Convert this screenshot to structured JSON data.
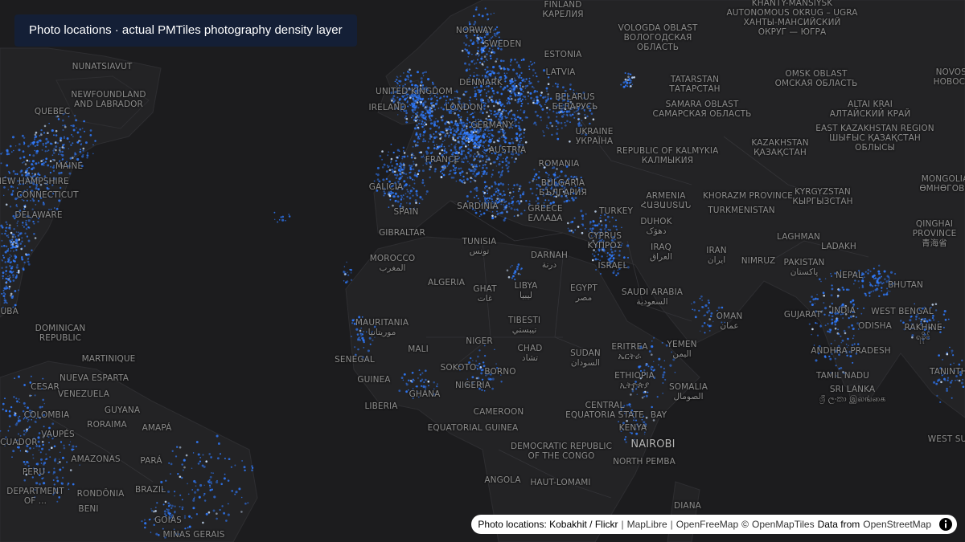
{
  "title": "Photo locations · actual PMTiles photography density layer",
  "attribution": {
    "credit": "Photo locations: Kobakhit / Flickr",
    "links": [
      "MapLibre",
      "OpenFreeMap",
      "OpenMapTiles"
    ],
    "copyright_symbol": "©",
    "data_from": "Data from",
    "osm": "OpenStreetMap",
    "info_icon": "info-icon"
  },
  "colors": {
    "background": "#1c1c1e",
    "land": "#1f1f21",
    "density": "#2f7bff",
    "density_hot": "#cfe4ff",
    "label": "#8c8c8c"
  },
  "labels": [
    {
      "name": "label-finland",
      "lines": [
        "FINLAND",
        "КАРЕЛИЯ"
      ]
    },
    {
      "name": "label-khanty",
      "lines": [
        "KHANTY-MANSIYSK",
        "AUTONOMOUS OKRUG – UGRA",
        "ХАНТЫ-МАНСИЙСКИЙ",
        "ОКРУГ — ЮГРА"
      ]
    },
    {
      "name": "label-vologda",
      "lines": [
        "VOLOGDA OBLAST",
        "ВОЛОГОДСКАЯ",
        "ОБЛАСТЬ"
      ]
    },
    {
      "name": "label-norway",
      "lines": [
        "NORWAY"
      ]
    },
    {
      "name": "label-sweden",
      "lines": [
        "SWEDEN"
      ]
    },
    {
      "name": "label-estonia",
      "lines": [
        "ESTONIA"
      ]
    },
    {
      "name": "label-latvia",
      "lines": [
        "LATVIA"
      ]
    },
    {
      "name": "label-nunatsiavut",
      "lines": [
        "NUNATSIAVUT"
      ]
    },
    {
      "name": "label-newfoundland",
      "lines": [
        "NEWFOUNDLAND",
        "AND LABRADOR"
      ]
    },
    {
      "name": "label-quebec",
      "lines": [
        "QUEBEC"
      ]
    },
    {
      "name": "label-tatarstan",
      "lines": [
        "TATARSTAN",
        "ТАТАРСТАН"
      ]
    },
    {
      "name": "label-omsk",
      "lines": [
        "OMSK OBLAST",
        "ОМСКАЯ ОБЛАСТЬ"
      ]
    },
    {
      "name": "label-novosib",
      "lines": [
        "NOVOSIB",
        "НОВОСИБ"
      ]
    },
    {
      "name": "label-united-kingdom",
      "lines": [
        "UNITED KINGDOM"
      ]
    },
    {
      "name": "label-ireland",
      "lines": [
        "IRELAND"
      ]
    },
    {
      "name": "label-denmark",
      "lines": [
        "DENMARK"
      ]
    },
    {
      "name": "label-london",
      "lines": [
        "LONDON"
      ]
    },
    {
      "name": "label-belarus",
      "lines": [
        "BELARUS",
        "БЕЛАРУСЬ"
      ]
    },
    {
      "name": "label-samara",
      "lines": [
        "SAMARA OBLAST",
        "САМАРСКАЯ ОБЛАСТЬ"
      ]
    },
    {
      "name": "label-altai",
      "lines": [
        "ALTAI KRAI",
        "АЛТАЙСКИЙ КРАЙ"
      ]
    },
    {
      "name": "label-germany",
      "lines": [
        "GERMANY"
      ]
    },
    {
      "name": "label-ukraine",
      "lines": [
        "UKRAINE",
        "УКРАЇНА"
      ]
    },
    {
      "name": "label-east-kazakhstan",
      "lines": [
        "EAST KAZAKHSTAN REGION",
        "ШЫҒЫС ҚАЗАҚСТАН",
        "ОБЛЫСЫ"
      ]
    },
    {
      "name": "label-kazakhstan",
      "lines": [
        "KAZAKHSTAN",
        "ҚАЗАҚСТАН"
      ]
    },
    {
      "name": "label-austria",
      "lines": [
        "AUSTRIA"
      ]
    },
    {
      "name": "label-kalmykia",
      "lines": [
        "REPUBLIC OF KALMYKIA",
        "КАЛМЫКИЯ"
      ]
    },
    {
      "name": "label-france",
      "lines": [
        "FRANCE"
      ]
    },
    {
      "name": "label-romania",
      "lines": [
        "ROMANIA"
      ]
    },
    {
      "name": "label-maine",
      "lines": [
        "MAINE"
      ]
    },
    {
      "name": "label-new-hampshire",
      "lines": [
        "NEW HAMPSHIRE"
      ]
    },
    {
      "name": "label-connecticut",
      "lines": [
        "CONNECTICUT"
      ]
    },
    {
      "name": "label-bulgaria",
      "lines": [
        "BULGARIA",
        "БЪЛГАРИЯ"
      ]
    },
    {
      "name": "label-galicia",
      "lines": [
        "GALICIA"
      ]
    },
    {
      "name": "label-armenia",
      "lines": [
        "ARMENIA",
        "ՀԱՅԱՍՏԱՆ"
      ]
    },
    {
      "name": "label-khorazm",
      "lines": [
        "KHORAZM PROVINCE"
      ]
    },
    {
      "name": "label-kyrgyzstan",
      "lines": [
        "KYRGYZSTAN",
        "КЫРГЫЗСТАН"
      ]
    },
    {
      "name": "label-mongolia",
      "lines": [
        "MONGOLIA",
        "ӨМНӨГОВЬ"
      ]
    },
    {
      "name": "label-delaware",
      "lines": [
        "DELAWARE"
      ]
    },
    {
      "name": "label-sardinia",
      "lines": [
        "SARDINIA"
      ]
    },
    {
      "name": "label-spain",
      "lines": [
        "SPAIN"
      ]
    },
    {
      "name": "label-greece",
      "lines": [
        "GREECE",
        "ΕΛΛΑΔΑ"
      ]
    },
    {
      "name": "label-turkey",
      "lines": [
        "TURKEY"
      ]
    },
    {
      "name": "label-duhok",
      "lines": [
        "DUHOK",
        "دهۆک"
      ]
    },
    {
      "name": "label-turkmenistan",
      "lines": [
        "TURKMENISTAN"
      ]
    },
    {
      "name": "label-qinghai",
      "lines": [
        "QINGHAI",
        "PROVINCE",
        "青海省"
      ]
    },
    {
      "name": "label-gibraltar",
      "lines": [
        "GIBRALTAR"
      ]
    },
    {
      "name": "label-tunisia",
      "lines": [
        "TUNISIA",
        "تونس"
      ]
    },
    {
      "name": "label-cyprus",
      "lines": [
        "CYPRUS",
        "ΚΥΠΡΟΣ"
      ]
    },
    {
      "name": "label-laghman",
      "lines": [
        "LAGHMAN"
      ]
    },
    {
      "name": "label-ladakh",
      "lines": [
        "LADAKH"
      ]
    },
    {
      "name": "label-iraq",
      "lines": [
        "IRAQ",
        "العراق"
      ]
    },
    {
      "name": "label-iran",
      "lines": [
        "IRAN",
        "ایران"
      ]
    },
    {
      "name": "label-morocco",
      "lines": [
        "MOROCCO",
        "المغرب"
      ]
    },
    {
      "name": "label-darnah",
      "lines": [
        "DARNAH",
        "درنة"
      ]
    },
    {
      "name": "label-israel",
      "lines": [
        "ISRAEL"
      ]
    },
    {
      "name": "label-nimruz",
      "lines": [
        "NIMRUZ"
      ]
    },
    {
      "name": "label-pakistan",
      "lines": [
        "PAKISTAN",
        "پاکستان"
      ]
    },
    {
      "name": "label-nepal",
      "lines": [
        "NEPAL"
      ]
    },
    {
      "name": "label-bhutan",
      "lines": [
        "BHUTAN"
      ]
    },
    {
      "name": "label-algeria",
      "lines": [
        "ALGERIA"
      ]
    },
    {
      "name": "label-libya",
      "lines": [
        "LIBYA",
        "ليبيا"
      ]
    },
    {
      "name": "label-ghat",
      "lines": [
        "GHAT",
        "غات"
      ]
    },
    {
      "name": "label-egypt",
      "lines": [
        "EGYPT",
        "مصر"
      ]
    },
    {
      "name": "label-saudi-arabia",
      "lines": [
        "SAUDI ARABIA",
        "السعودية"
      ]
    },
    {
      "name": "label-gujarat",
      "lines": [
        "GUJARAT"
      ]
    },
    {
      "name": "label-india",
      "lines": [
        "INDIA"
      ]
    },
    {
      "name": "label-west-bengal",
      "lines": [
        "WEST BENGAL"
      ]
    },
    {
      "name": "label-oman",
      "lines": [
        "OMAN",
        "عمان"
      ]
    },
    {
      "name": "label-odisha",
      "lines": [
        "ODISHA"
      ]
    },
    {
      "name": "label-rakhine",
      "lines": [
        "RAKHINE",
        "ရခိုင်"
      ]
    },
    {
      "name": "label-cuba",
      "lines": [
        "CUBA"
      ]
    },
    {
      "name": "label-dominican",
      "lines": [
        "DOMINICAN",
        "REPUBLIC"
      ]
    },
    {
      "name": "label-mauritania",
      "lines": [
        "MAURITANIA",
        "موريتانيا"
      ]
    },
    {
      "name": "label-tibesti",
      "lines": [
        "TIBESTI",
        "تيبستي"
      ]
    },
    {
      "name": "label-mali",
      "lines": [
        "MALI"
      ]
    },
    {
      "name": "label-niger",
      "lines": [
        "NIGER"
      ]
    },
    {
      "name": "label-eritrea",
      "lines": [
        "ERITREA",
        "ኤርትራ"
      ]
    },
    {
      "name": "label-yemen",
      "lines": [
        "YEMEN",
        "اليمن"
      ]
    },
    {
      "name": "label-andhra",
      "lines": [
        "ANDHRA PRADESH"
      ]
    },
    {
      "name": "label-martinique",
      "lines": [
        "MARTINIQUE"
      ]
    },
    {
      "name": "label-senegal",
      "lines": [
        "SENEGAL"
      ]
    },
    {
      "name": "label-chad",
      "lines": [
        "CHAD",
        "تشاد"
      ]
    },
    {
      "name": "label-sudan",
      "lines": [
        "SUDAN",
        "السودان"
      ]
    },
    {
      "name": "label-nueva-esparta",
      "lines": [
        "NUEVA ESPARTA"
      ]
    },
    {
      "name": "label-sokoto",
      "lines": [
        "SOKOTO"
      ]
    },
    {
      "name": "label-borno",
      "lines": [
        "BORNO"
      ]
    },
    {
      "name": "label-ethiopia",
      "lines": [
        "ETHIOPIA",
        "ኢትዮጵያ"
      ]
    },
    {
      "name": "label-tamil-nadu",
      "lines": [
        "TAMIL NADU"
      ]
    },
    {
      "name": "label-tanintharyi",
      "lines": [
        "TANINTHA"
      ]
    },
    {
      "name": "label-guinea",
      "lines": [
        "GUINEA"
      ]
    },
    {
      "name": "label-nigeria",
      "lines": [
        "NIGERIA"
      ]
    },
    {
      "name": "label-venezuela",
      "lines": [
        "VENEZUELA"
      ]
    },
    {
      "name": "label-cesar",
      "lines": [
        "CESAR"
      ]
    },
    {
      "name": "label-sri-lanka",
      "lines": [
        "SRI LANKA",
        "ශ්‍රී ලංකා இலங்கை"
      ]
    },
    {
      "name": "label-somalia",
      "lines": [
        "SOMALIA",
        "الصومال"
      ]
    },
    {
      "name": "label-ghana",
      "lines": [
        "GHANA"
      ]
    },
    {
      "name": "label-guyana",
      "lines": [
        "GUYANA"
      ]
    },
    {
      "name": "label-colombia",
      "lines": [
        "COLOMBIA"
      ]
    },
    {
      "name": "label-liberia",
      "lines": [
        "LIBERIA"
      ]
    },
    {
      "name": "label-central-equatoria",
      "lines": [
        "CENTRAL",
        "EQUATORIA STATE"
      ]
    },
    {
      "name": "label-bay",
      "lines": [
        "BAY"
      ]
    },
    {
      "name": "label-cameroon",
      "lines": [
        "CAMEROON"
      ]
    },
    {
      "name": "label-roraima",
      "lines": [
        "RORAIMA"
      ]
    },
    {
      "name": "label-amapa",
      "lines": [
        "AMAPÁ"
      ]
    },
    {
      "name": "label-vaupes",
      "lines": [
        "VAUPÉS"
      ]
    },
    {
      "name": "label-equatorial-guinea",
      "lines": [
        "EQUATORIAL GUINEA"
      ]
    },
    {
      "name": "label-kenya",
      "lines": [
        "KENYA"
      ]
    },
    {
      "name": "label-west-sumatra",
      "lines": [
        "WEST SU"
      ]
    },
    {
      "name": "label-ecuador",
      "lines": [
        "ECUADOR"
      ]
    },
    {
      "name": "label-drc",
      "lines": [
        "DEMOCRATIC REPUBLIC",
        "OF THE CONGO"
      ]
    },
    {
      "name": "label-nairobi",
      "lines": [
        "NAIROBI"
      ]
    },
    {
      "name": "label-amazonas",
      "lines": [
        "AMAZONAS"
      ]
    },
    {
      "name": "label-north-pemba",
      "lines": [
        "NORTH PEMBA"
      ]
    },
    {
      "name": "label-para",
      "lines": [
        "PARÁ"
      ]
    },
    {
      "name": "label-peru",
      "lines": [
        "PERU"
      ]
    },
    {
      "name": "label-angola",
      "lines": [
        "ANGOLA"
      ]
    },
    {
      "name": "label-haut-lomami",
      "lines": [
        "HAUT-LOMAMI"
      ]
    },
    {
      "name": "label-brazil",
      "lines": [
        "BRAZIL"
      ]
    },
    {
      "name": "label-rondonia",
      "lines": [
        "RONDÔNIA"
      ]
    },
    {
      "name": "label-department",
      "lines": [
        "DEPARTMENT",
        "OF ..."
      ]
    },
    {
      "name": "label-beni",
      "lines": [
        "BENI"
      ]
    },
    {
      "name": "label-goias",
      "lines": [
        "GOIÁS"
      ]
    },
    {
      "name": "label-diana",
      "lines": [
        "DIANA"
      ]
    },
    {
      "name": "label-minas-gerais",
      "lines": [
        "MINAS GERAIS"
      ]
    }
  ]
}
